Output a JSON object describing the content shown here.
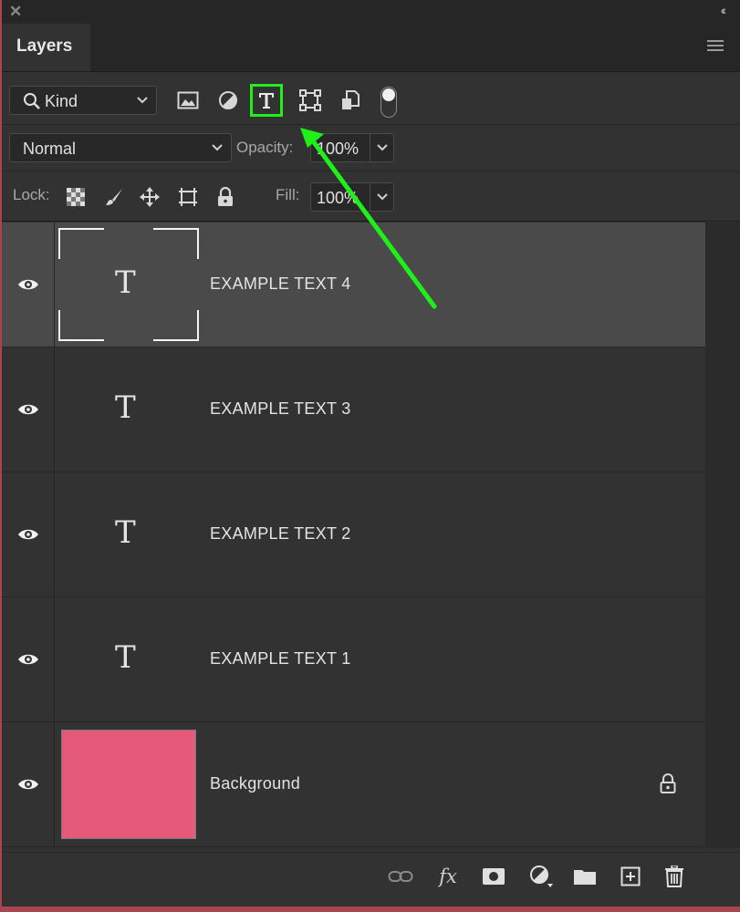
{
  "panel": {
    "tab_label": "Layers",
    "close_glyph": "✕",
    "collapse_glyph": "‹‹"
  },
  "filter": {
    "kind_label": "Kind",
    "buttons": [
      "image-filter-icon",
      "adjustment-filter-icon",
      "type-filter-icon",
      "shape-filter-icon",
      "smart-object-filter-icon",
      "filter-toggle"
    ],
    "highlight_color": "#1ff01a"
  },
  "blend": {
    "mode": "Normal",
    "opacity_label": "Opacity:",
    "opacity_value": "100%"
  },
  "lock": {
    "label": "Lock:",
    "fill_label": "Fill:",
    "fill_value": "100%"
  },
  "layers": [
    {
      "name": "EXAMPLE TEXT 4",
      "type": "text",
      "selected": true,
      "thumb_glyph": "T"
    },
    {
      "name": "EXAMPLE TEXT 3",
      "type": "text",
      "selected": false,
      "thumb_glyph": "T"
    },
    {
      "name": "EXAMPLE TEXT 2",
      "type": "text",
      "selected": false,
      "thumb_glyph": "T"
    },
    {
      "name": "EXAMPLE TEXT 1",
      "type": "text",
      "selected": false,
      "thumb_glyph": "T"
    },
    {
      "name": "Background",
      "type": "background",
      "selected": false,
      "locked": true,
      "fill_color": "#e55a78"
    }
  ],
  "bottom_toolbar": {
    "fx_label": "fx",
    "icons": [
      "link-layers-icon",
      "layer-style-icon",
      "add-mask-icon",
      "adjustment-layer-icon",
      "new-group-icon",
      "new-layer-icon",
      "delete-layer-icon"
    ]
  },
  "annotation": {
    "arrow_color": "#1ff01a"
  }
}
